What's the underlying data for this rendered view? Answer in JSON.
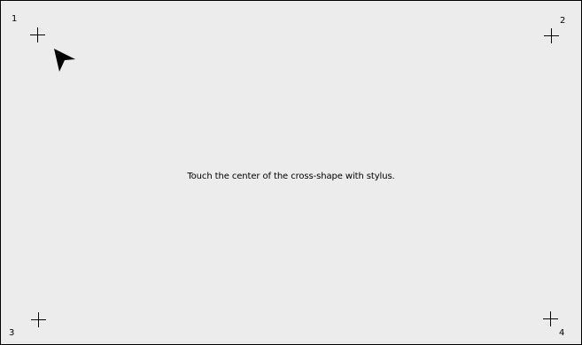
{
  "calibration": {
    "instruction": "Touch the center of the cross-shape with stylus.",
    "targets": [
      {
        "label": "1",
        "icon": "crosshair-icon"
      },
      {
        "label": "2",
        "icon": "crosshair-icon"
      },
      {
        "label": "3",
        "icon": "crosshair-icon"
      },
      {
        "label": "4",
        "icon": "crosshair-icon"
      }
    ],
    "pointer": "arrow-cursor-icon",
    "colors": {
      "background": "#ececec",
      "border": "#000000",
      "foreground": "#000000"
    }
  }
}
